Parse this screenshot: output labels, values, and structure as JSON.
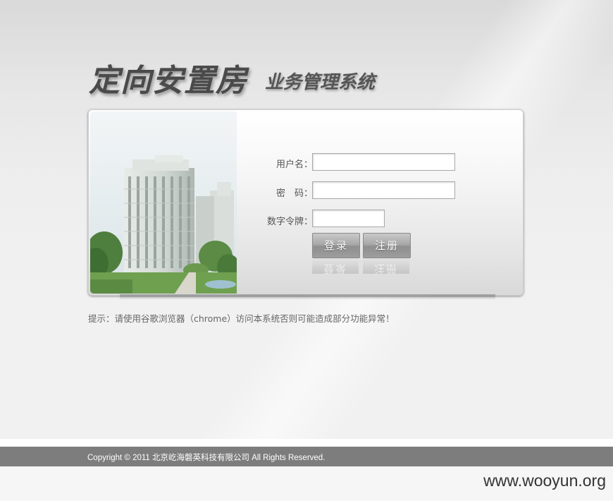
{
  "header": {
    "title_main": "定向安置房",
    "title_sub": "业务管理系统"
  },
  "login_form": {
    "username_label": "用户名：",
    "username_value": "",
    "password_label": "密　码：",
    "password_value": "",
    "token_label": "数字令牌：",
    "token_value": "",
    "login_button": "登录",
    "register_button": "注册"
  },
  "hint": {
    "text": "提示：请使用谷歌浏览器（chrome）访问本系统否则可能造成部分功能异常！"
  },
  "footer": {
    "copyright": "Copyright © 2011 北京屹海磐英科技有限公司 All Rights Reserved."
  },
  "watermark": {
    "text": "www.wooyun.org"
  },
  "colors": {
    "footer_bg": "#7d7d7d",
    "button_gray": "#9d9d9d"
  }
}
